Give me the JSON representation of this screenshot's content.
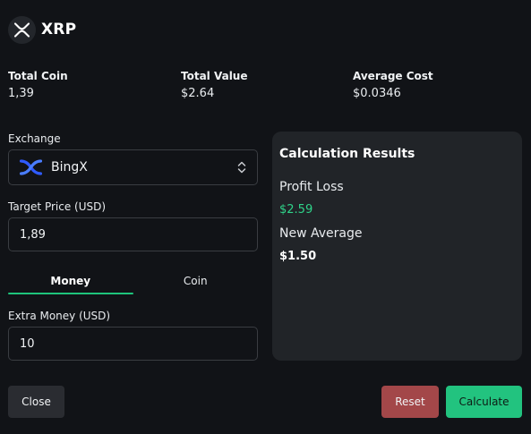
{
  "header": {
    "coin_name": "XRP",
    "logo_icon": "xrp-logo-icon"
  },
  "stats": {
    "total_coin_label": "Total Coin",
    "total_coin_value": "1,39",
    "total_value_label": "Total Value",
    "total_value_value": "$2.64",
    "average_cost_label": "Average Cost",
    "average_cost_value": "$0.0346"
  },
  "form": {
    "exchange_label": "Exchange",
    "exchange_selected": "BingX",
    "exchange_icon": "bingx-logo-icon",
    "target_price_label": "Target Price (USD)",
    "target_price_value": "1,89",
    "tabs": [
      {
        "label": "Money",
        "active": true
      },
      {
        "label": "Coin",
        "active": false
      }
    ],
    "extra_money_label": "Extra Money (USD)",
    "extra_money_value": "10"
  },
  "results": {
    "title": "Calculation Results",
    "profit_loss_label": "Profit Loss",
    "profit_loss_value": "$2.59",
    "new_average_label": "New Average",
    "new_average_value": "$1.50"
  },
  "buttons": {
    "close": "Close",
    "reset": "Reset",
    "calculate": "Calculate"
  },
  "colors": {
    "accent_green": "#1ec47c",
    "profit_green": "#2fd48a",
    "reset_red": "#a34749",
    "bingx_blue": "#2f5bff"
  }
}
